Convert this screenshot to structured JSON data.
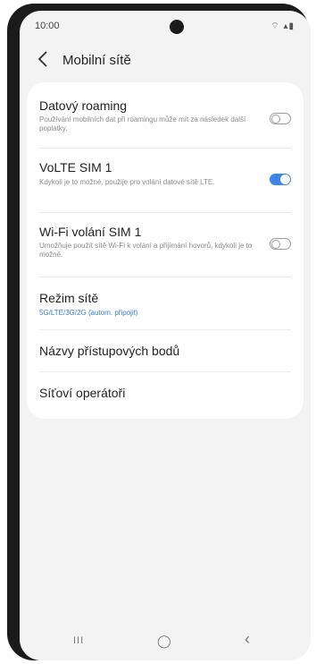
{
  "status": {
    "time": "10:00",
    "icons": "⌔ ▴▮"
  },
  "header": {
    "back_icon": "chevron-left-icon",
    "title": "Mobilní sítě"
  },
  "settings": {
    "data_roaming": {
      "title": "Datový roaming",
      "description": "Používání mobilních dat při roamingu může mít za následek další poplatky.",
      "enabled": false
    },
    "volte": {
      "title": "VoLTE SIM 1",
      "description": "Kdykoli je to možné, použije pro volání datové sítě LTE.",
      "enabled": true
    },
    "wifi_calling": {
      "title": "Wi-Fi volání SIM 1",
      "description": "Umožňuje použít sítě Wi-Fi k volání a přijímání hovorů, kdykoli je to možné.",
      "enabled": false
    },
    "network_mode": {
      "title": "Režim sítě",
      "value": "5G/LTE/3G/2G (autom. připojit)"
    },
    "apn": {
      "title": "Názvy přístupových bodů"
    },
    "operators": {
      "title": "Síťoví operátoři"
    }
  },
  "navbar": {
    "recents": "III",
    "home": "◯",
    "back": "‹"
  },
  "colors": {
    "accent": "#3e86e6",
    "background": "#f3f3f3"
  }
}
